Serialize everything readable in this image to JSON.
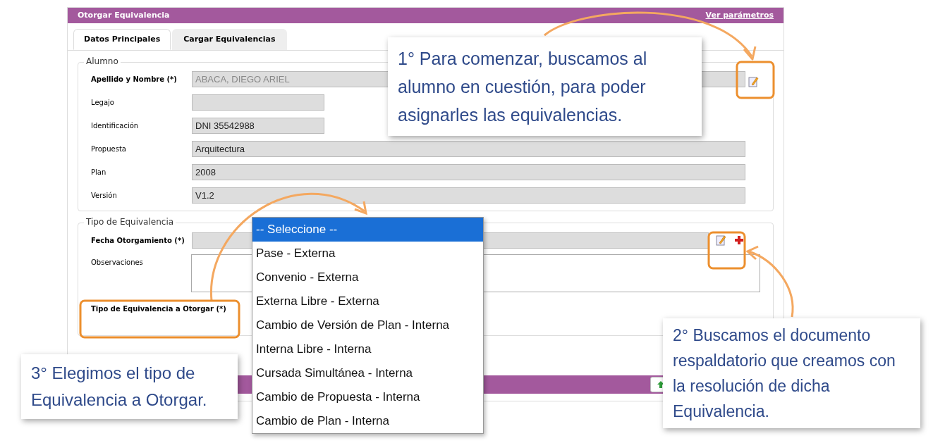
{
  "window": {
    "title": "Otorgar Equivalencia",
    "link": "Ver parámetros"
  },
  "tabs": [
    {
      "label": "Datos Principales",
      "selected": true
    },
    {
      "label": "Cargar Equivalencias",
      "selected": false
    }
  ],
  "alumno": {
    "legend": "Alumno",
    "fields": [
      {
        "label": "Apellido y Nombre (*)",
        "value": "ABACA, DIEGO ARIEL",
        "kind": "search"
      },
      {
        "label": "Legajo",
        "kind": "short"
      },
      {
        "label": "Identificación",
        "value": "DNI 35542988",
        "kind": "short"
      },
      {
        "label": "Propuesta",
        "value": "Arquitectura",
        "kind": "full"
      },
      {
        "label": "Plan",
        "value": "2008",
        "kind": "full"
      },
      {
        "label": "Versión",
        "value": "V1.2",
        "kind": "full"
      }
    ]
  },
  "tipo": {
    "legend": "Tipo de Equivalencia",
    "fecha_label": "Fecha Otorgamiento (*)",
    "observaciones_label": "Observaciones",
    "tipo_label": "Tipo de Equivalencia a Otorgar (*)"
  },
  "dropdown": {
    "options": [
      {
        "label": "-- Seleccione --",
        "selected": true
      },
      {
        "label": "Pase - Externa",
        "selected": false
      },
      {
        "label": "Convenio - Externa",
        "selected": false
      },
      {
        "label": "Externa Libre - Externa",
        "selected": false
      },
      {
        "label": "Cambio de Versión de Plan - Interna",
        "selected": false
      },
      {
        "label": "Interna Libre - Interna",
        "selected": false
      },
      {
        "label": "Cursada Simultánea - Interna",
        "selected": false
      },
      {
        "label": "Cambio de Propuesta - Interna",
        "selected": false
      },
      {
        "label": "Cambio de Plan - Interna",
        "selected": false
      }
    ]
  },
  "callouts": [
    {
      "text": "1° Para comenzar, buscamos al alumno en cuestión, para poder asignarles las equivalencias."
    },
    {
      "text": "2° Buscamos el documento respaldatorio que creamos con la resolución de dicha Equivalencia."
    },
    {
      "text": "3° Elegimos el tipo de Equivalencia a Otorgar."
    }
  ]
}
